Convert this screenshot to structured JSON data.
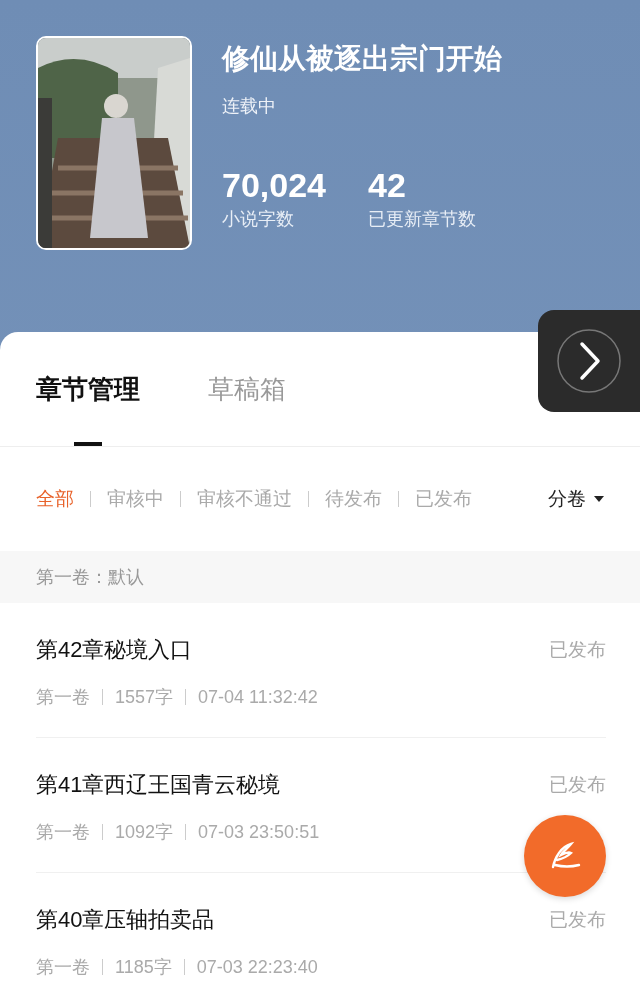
{
  "book": {
    "title": "修仙从被逐出宗门开始",
    "status": "连载中",
    "stats": [
      {
        "value": "70,024",
        "label": "小说字数"
      },
      {
        "value": "42",
        "label": "已更新章节数"
      }
    ]
  },
  "tabs": [
    {
      "label": "章节管理",
      "selected": true
    },
    {
      "label": "草稿箱",
      "selected": false
    }
  ],
  "filters": [
    {
      "label": "全部",
      "selected": true
    },
    {
      "label": "审核中",
      "selected": false
    },
    {
      "label": "审核不通过",
      "selected": false
    },
    {
      "label": "待发布",
      "selected": false
    },
    {
      "label": "已发布",
      "selected": false
    }
  ],
  "volume_dropdown": {
    "label": "分卷"
  },
  "group": {
    "title": "第一卷：默认"
  },
  "chapters": [
    {
      "title": "第42章秘境入口",
      "status": "已发布",
      "volume": "第一卷",
      "words": "1557字",
      "time": "07-04 11:32:42"
    },
    {
      "title": "第41章西辽王国青云秘境",
      "status": "已发布",
      "volume": "第一卷",
      "words": "1092字",
      "time": "07-03 23:50:51"
    },
    {
      "title": "第40章压轴拍卖品",
      "status": "已发布",
      "volume": "第一卷",
      "words": "1185字",
      "time": "07-03 22:23:40"
    }
  ]
}
